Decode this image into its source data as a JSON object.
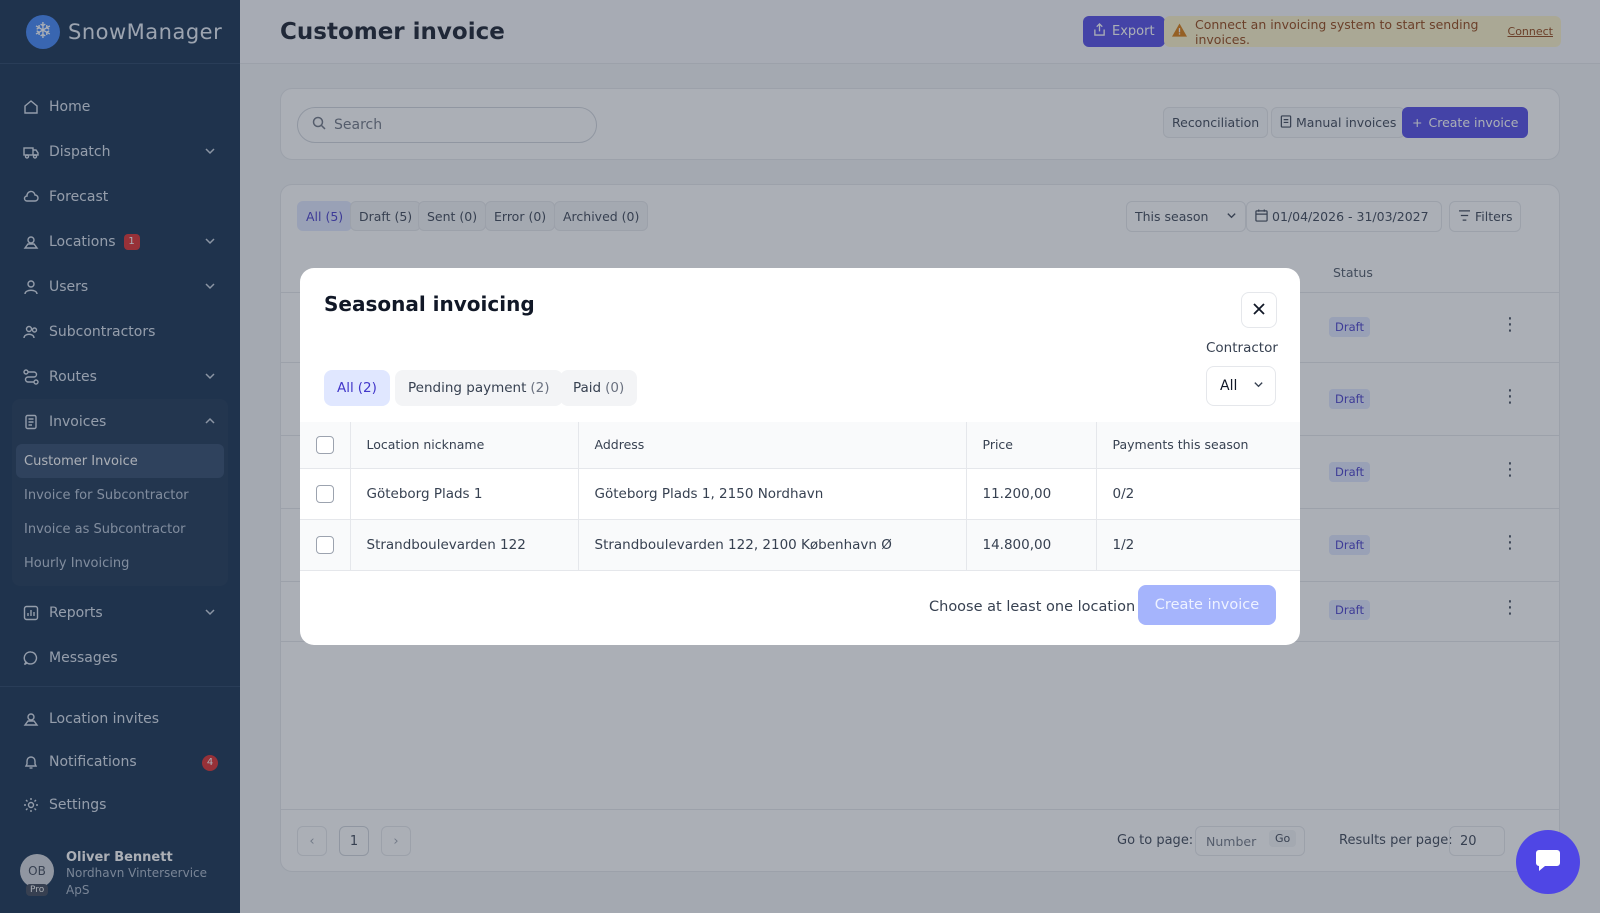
{
  "app": {
    "name": "SnowManager"
  },
  "sidebar": {
    "items": [
      {
        "label": "Home",
        "icon": "home-icon"
      },
      {
        "label": "Dispatch",
        "icon": "truck-icon",
        "expandable": true
      },
      {
        "label": "Forecast",
        "icon": "cloud-icon"
      },
      {
        "label": "Locations",
        "icon": "location-icon",
        "badge": "1",
        "expandable": true
      },
      {
        "label": "Users",
        "icon": "user-icon",
        "expandable": true
      },
      {
        "label": "Subcontractors",
        "icon": "users-icon"
      },
      {
        "label": "Routes",
        "icon": "route-icon",
        "expandable": true
      }
    ],
    "invoices": {
      "label": "Invoices",
      "sub_items": [
        "Customer Invoice",
        "Invoice for Subcontractor",
        "Invoice as Subcontractor",
        "Hourly Invoicing"
      ],
      "active_sub": "Customer Invoice"
    },
    "after_items": [
      {
        "label": "Reports",
        "icon": "chart-icon",
        "expandable": true
      },
      {
        "label": "Messages",
        "icon": "message-icon"
      }
    ],
    "bottom_items": [
      {
        "label": "Location invites",
        "icon": "location-icon"
      },
      {
        "label": "Notifications",
        "icon": "bell-icon",
        "badge": "4"
      },
      {
        "label": "Settings",
        "icon": "gear-icon"
      }
    ],
    "profile": {
      "initials": "OB",
      "tier": "Pro",
      "name": "Oliver Bennett",
      "company": "Nordhavn Vinterservice ApS"
    }
  },
  "header": {
    "title": "Customer invoice",
    "export_label": "Export",
    "warning_text": "Connect an invoicing system to start sending invoices.",
    "warning_link": "Connect"
  },
  "toolbar": {
    "search_placeholder": "Search",
    "reconciliation_label": "Reconciliation",
    "manual_invoices_label": "Manual invoices",
    "create_invoice_label": "Create invoice"
  },
  "list": {
    "tabs": [
      "All (5)",
      "Draft (5)",
      "Sent (0)",
      "Error (0)",
      "Archived (0)"
    ],
    "period_select": "This season",
    "date_range": "01/04/2026 - 31/03/2027",
    "filters_label": "Filters",
    "status_header": "Status",
    "rows": [
      {
        "status": "Draft"
      },
      {
        "status": "Draft"
      },
      {
        "status": "Draft"
      },
      {
        "status": "Draft"
      },
      {
        "status": "Draft"
      }
    ],
    "pager": {
      "current_page": "1",
      "goto_label": "Go to page:",
      "number_placeholder": "Number",
      "go_label": "Go",
      "results_label": "Results per page:",
      "results_value": "20"
    }
  },
  "modal": {
    "title": "Seasonal invoicing",
    "tabs": [
      {
        "label": "All",
        "count": "(2)"
      },
      {
        "label": "Pending payment",
        "count": "(2)"
      },
      {
        "label": "Paid",
        "count": "(0)"
      }
    ],
    "contractor_label": "Contractor",
    "contractor_value": "All",
    "columns": [
      "Location nickname",
      "Address",
      "Price",
      "Payments this season"
    ],
    "rows": [
      {
        "nickname": "Göteborg Plads 1",
        "address": "Göteborg Plads 1, 2150 Nordhavn",
        "price": "11.200,00",
        "payments": "0/2"
      },
      {
        "nickname": "Strandboulevarden 122",
        "address": "Strandboulevarden 122, 2100 København Ø",
        "price": "14.800,00",
        "payments": "1/2"
      }
    ],
    "hint": "Choose at least one location",
    "create_label": "Create invoice"
  },
  "colors": {
    "accent": "#4f46e5",
    "sidebar_bg": "#0f2a4a",
    "draft_bg": "#e0e7ff",
    "disabled_button": "#a5b4fc"
  }
}
